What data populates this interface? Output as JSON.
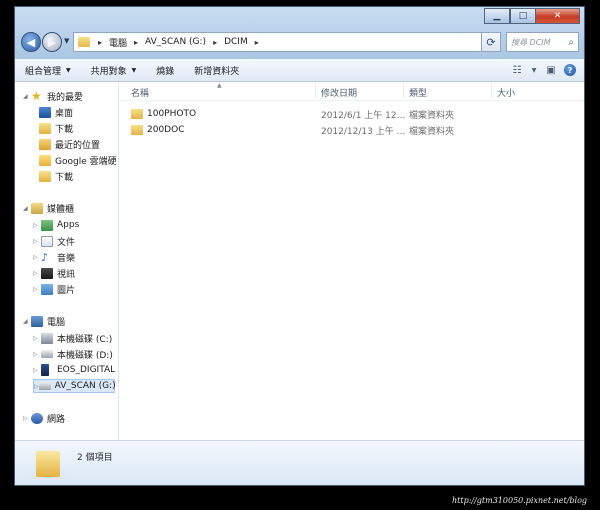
{
  "window": {
    "controls": {
      "minimize": "▁",
      "maximize": "□",
      "close": "✕"
    }
  },
  "address": {
    "segments": [
      "電腦",
      "AV_SCAN (G:)",
      "DCIM"
    ],
    "arrow": "▸"
  },
  "search": {
    "placeholder": "搜尋 DCIM"
  },
  "commands": {
    "organize": "組合管理",
    "share": "共用對象",
    "burn": "燒錄",
    "new_folder": "新增資料夾"
  },
  "nav": {
    "favorites": {
      "label": "我的最愛",
      "items": [
        "桌面",
        "下載",
        "最近的位置",
        "Google 雲端硬",
        "下載"
      ]
    },
    "libraries": {
      "label": "媒體櫃",
      "items": [
        "Apps",
        "文件",
        "音樂",
        "視訊",
        "圖片"
      ]
    },
    "computer": {
      "label": "電腦",
      "items": [
        "本機磁碟 (C:)",
        "本機磁碟 (D:)",
        "EOS_DIGITAL (",
        "AV_SCAN (G:)"
      ]
    },
    "network": {
      "label": "網路"
    }
  },
  "columns": {
    "name": "名稱",
    "modified": "修改日期",
    "type": "類型",
    "size": "大小"
  },
  "files": [
    {
      "name": "100PHOTO",
      "modified": "2012/6/1 上午 12...",
      "type": "檔案資料夾"
    },
    {
      "name": "200DOC",
      "modified": "2012/12/13 上午 ...",
      "type": "檔案資料夾"
    }
  ],
  "details": {
    "count": "2 個項目"
  },
  "watermark": "http://gtm310050.pixnet.net/blog"
}
